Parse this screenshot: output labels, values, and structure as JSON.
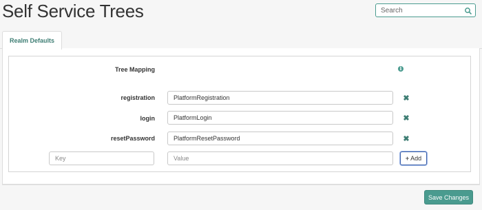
{
  "page": {
    "title": "Self Service Trees"
  },
  "search": {
    "placeholder": "Search",
    "icon": "search-icon"
  },
  "tabs": [
    {
      "label": "Realm Defaults",
      "active": true
    }
  ],
  "tree_mapping": {
    "label": "Tree Mapping",
    "info_icon": "info-icon",
    "rows": [
      {
        "key": "registration",
        "value": "PlatformRegistration"
      },
      {
        "key": "login",
        "value": "PlatformLogin"
      },
      {
        "key": "resetPassword",
        "value": "PlatformResetPassword"
      }
    ],
    "new_entry": {
      "key_placeholder": "Key",
      "value_placeholder": "Value",
      "add_label": "Add"
    }
  },
  "footer": {
    "save_label": "Save Changes"
  },
  "colors": {
    "accent": "#4a9b8f",
    "tab_text": "#3d7d73",
    "focus_border": "#3a5fa8"
  }
}
